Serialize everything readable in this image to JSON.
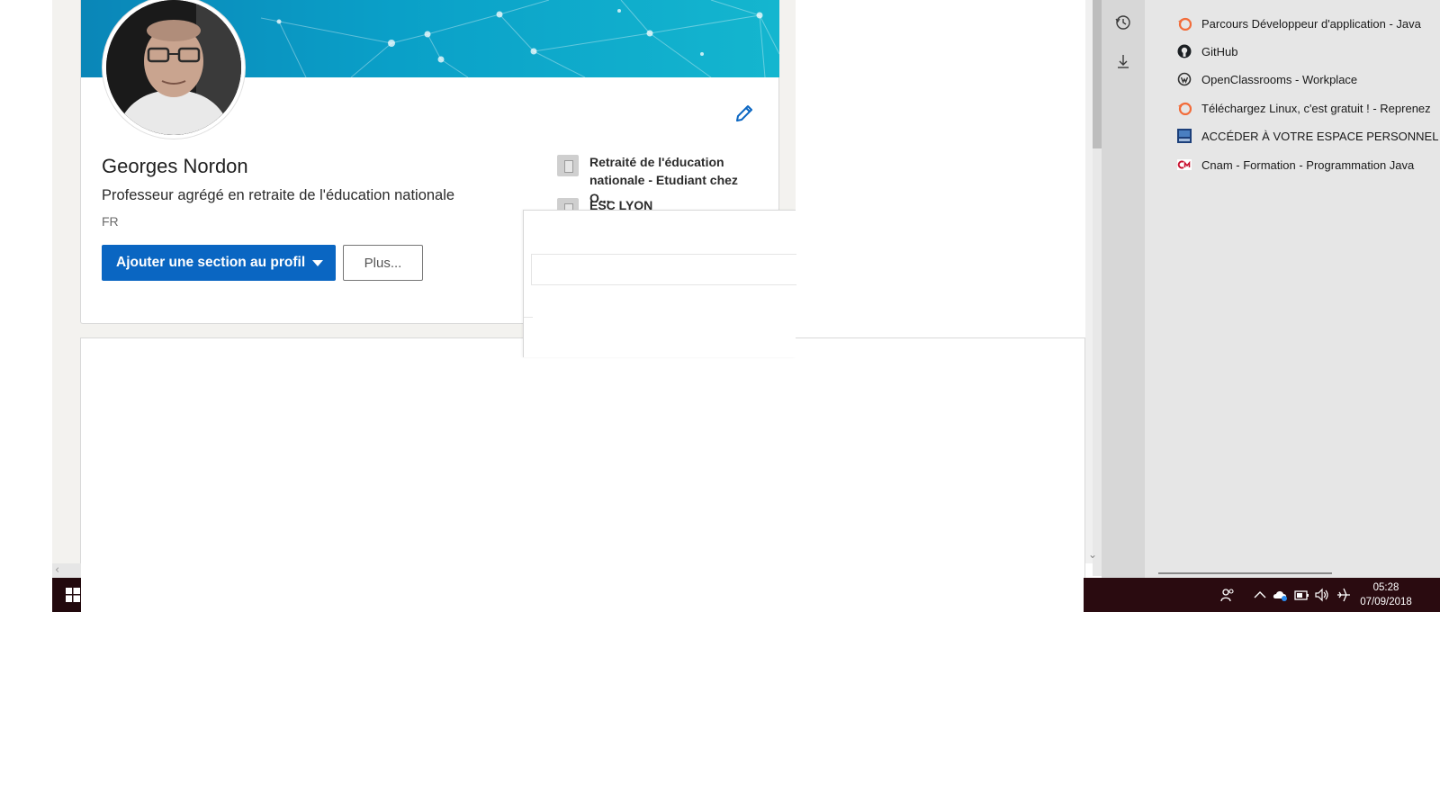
{
  "profile": {
    "name": "Georges Nordon",
    "headline": "Professeur agrégé en retraite de l'éducation nationale",
    "location": "FR",
    "add_section_label": "Ajouter une section au profil",
    "more_label": "Plus...",
    "experience": [
      {
        "text": "Retraité de l'éducation nationale - Etudiant chez O..."
      },
      {
        "text": "ESC LYON"
      }
    ]
  },
  "hub": {
    "favorites": [
      {
        "label": "Parcours Développeur d'application - Java",
        "icon": "openclassrooms-logo-icon"
      },
      {
        "label": "GitHub",
        "icon": "github-logo-icon"
      },
      {
        "label": "OpenClassrooms - Workplace",
        "icon": "workplace-logo-icon"
      },
      {
        "label": "Téléchargez Linux, c'est gratuit ! - Reprenez",
        "icon": "openclassrooms-logo-icon"
      },
      {
        "label": "ACCÉDER À VOTRE ESPACE PERSONNEL –",
        "icon": "site-logo-icon"
      },
      {
        "label": "Cnam - Formation - Programmation Java",
        "icon": "cnam-logo-icon"
      }
    ]
  },
  "taskbar": {
    "time": "05:28",
    "date": "07/09/2018"
  },
  "colors": {
    "linkedin_blue": "#0a66c2",
    "taskbar": "#2a0b10"
  }
}
